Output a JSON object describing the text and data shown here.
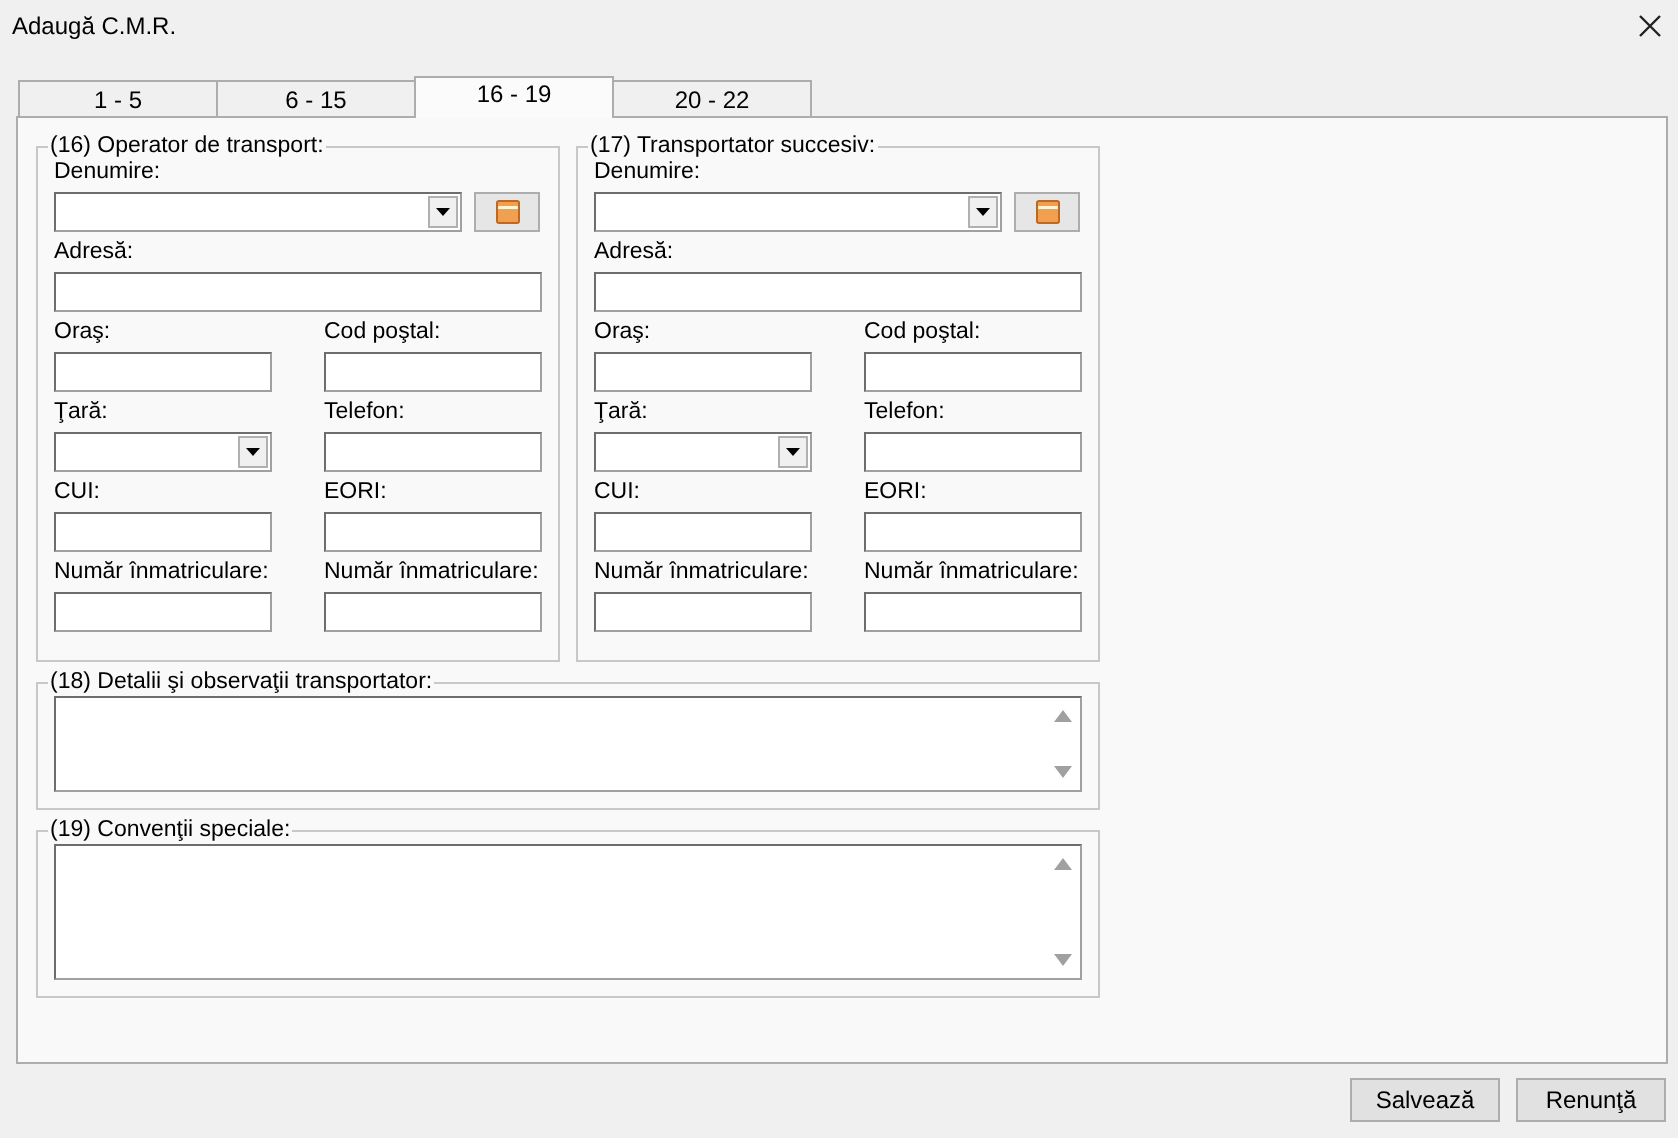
{
  "window": {
    "title": "Adaugă C.M.R."
  },
  "tabs": [
    {
      "label": "1 - 5",
      "selected": false
    },
    {
      "label": "6 - 15",
      "selected": false
    },
    {
      "label": "16 - 19",
      "selected": true
    },
    {
      "label": "20 - 22",
      "selected": false
    }
  ],
  "carriers": [
    {
      "title": "(16) Operator de transport:",
      "rows": [
        [
          {
            "label": "Denumire:",
            "kind": "lookup"
          }
        ],
        [
          {
            "label": "Adresă:",
            "kind": "text"
          }
        ],
        [
          {
            "label": "Oraş:",
            "kind": "text"
          },
          {
            "label": "Cod poştal:",
            "kind": "text"
          }
        ],
        [
          {
            "label": "Ţară:",
            "kind": "combo"
          },
          {
            "label": "Telefon:",
            "kind": "text"
          }
        ],
        [
          {
            "label": "CUI:",
            "kind": "text"
          },
          {
            "label": "EORI:",
            "kind": "text"
          }
        ],
        [
          {
            "label": "Număr înmatriculare:",
            "kind": "text"
          },
          {
            "label": "Număr înmatriculare:",
            "kind": "text"
          }
        ]
      ]
    },
    {
      "title": "(17) Transportator succesiv:",
      "rows": [
        [
          {
            "label": "Denumire:",
            "kind": "lookup"
          }
        ],
        [
          {
            "label": "Adresă:",
            "kind": "text"
          }
        ],
        [
          {
            "label": "Oraş:",
            "kind": "text"
          },
          {
            "label": "Cod poştal:",
            "kind": "text"
          }
        ],
        [
          {
            "label": "Ţară:",
            "kind": "combo"
          },
          {
            "label": "Telefon:",
            "kind": "text"
          }
        ],
        [
          {
            "label": "CUI:",
            "kind": "text"
          },
          {
            "label": "EORI:",
            "kind": "text"
          }
        ],
        [
          {
            "label": "Număr înmatriculare:",
            "kind": "text"
          },
          {
            "label": "Număr înmatriculare:",
            "kind": "text"
          }
        ]
      ]
    }
  ],
  "notes": [
    {
      "title": "(18) Detalii şi observaţii transportator:"
    },
    {
      "title": "(19) Convenţii speciale:"
    }
  ],
  "buttons": [
    "Salvează",
    "Renunţă"
  ]
}
